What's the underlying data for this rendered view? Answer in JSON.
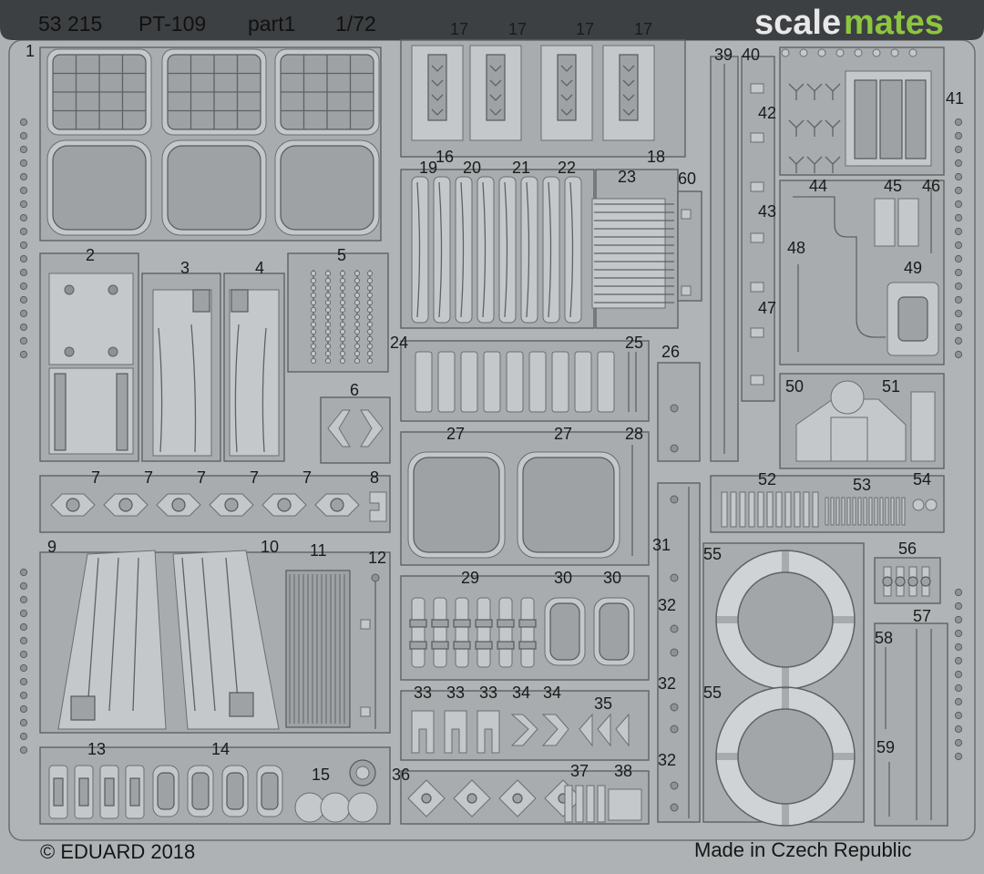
{
  "header": {
    "product_code": "53 215",
    "subject": "PT-109",
    "part": "part1",
    "scale": "1/72"
  },
  "watermark": {
    "part_a": "scale",
    "part_b": "mates",
    "color_a": "#e8e8e8",
    "color_b": "#8cc63f"
  },
  "footer": {
    "copyright": "© EDUARD 2018",
    "origin": "Made in Czech Republic"
  },
  "colors": {
    "fret": "#aeb2b4",
    "header_band": "#3d4042",
    "part": "#a8acae",
    "outline": "#5e6264"
  },
  "part_numbers": {
    "n1": "1",
    "n2": "2",
    "n3": "3",
    "n4": "4",
    "n5": "5",
    "n6": "6",
    "n7a": "7",
    "n7b": "7",
    "n7c": "7",
    "n7d": "7",
    "n7e": "7",
    "n8": "8",
    "n9": "9",
    "n10": "10",
    "n11": "11",
    "n12": "12",
    "n13": "13",
    "n14": "14",
    "n15": "15",
    "n16": "16",
    "n17a": "17",
    "n17b": "17",
    "n17c": "17",
    "n17d": "17",
    "n18": "18",
    "n19": "19",
    "n20": "20",
    "n21": "21",
    "n22": "22",
    "n23": "23",
    "n24": "24",
    "n25": "25",
    "n26": "26",
    "n27a": "27",
    "n27b": "27",
    "n28": "28",
    "n29": "29",
    "n30a": "30",
    "n30b": "30",
    "n31": "31",
    "n32a": "32",
    "n32b": "32",
    "n32c": "32",
    "n33a": "33",
    "n33b": "33",
    "n33c": "33",
    "n34a": "34",
    "n34b": "34",
    "n35": "35",
    "n36": "36",
    "n37": "37",
    "n38": "38",
    "n39": "39",
    "n40": "40",
    "n41": "41",
    "n42": "42",
    "n43": "43",
    "n44": "44",
    "n45": "45",
    "n46": "46",
    "n47": "47",
    "n48": "48",
    "n49": "49",
    "n50": "50",
    "n51": "51",
    "n52": "52",
    "n53": "53",
    "n54": "54",
    "n55a": "55",
    "n55b": "55",
    "n56": "56",
    "n57": "57",
    "n58": "58",
    "n59": "59",
    "n60": "60"
  }
}
